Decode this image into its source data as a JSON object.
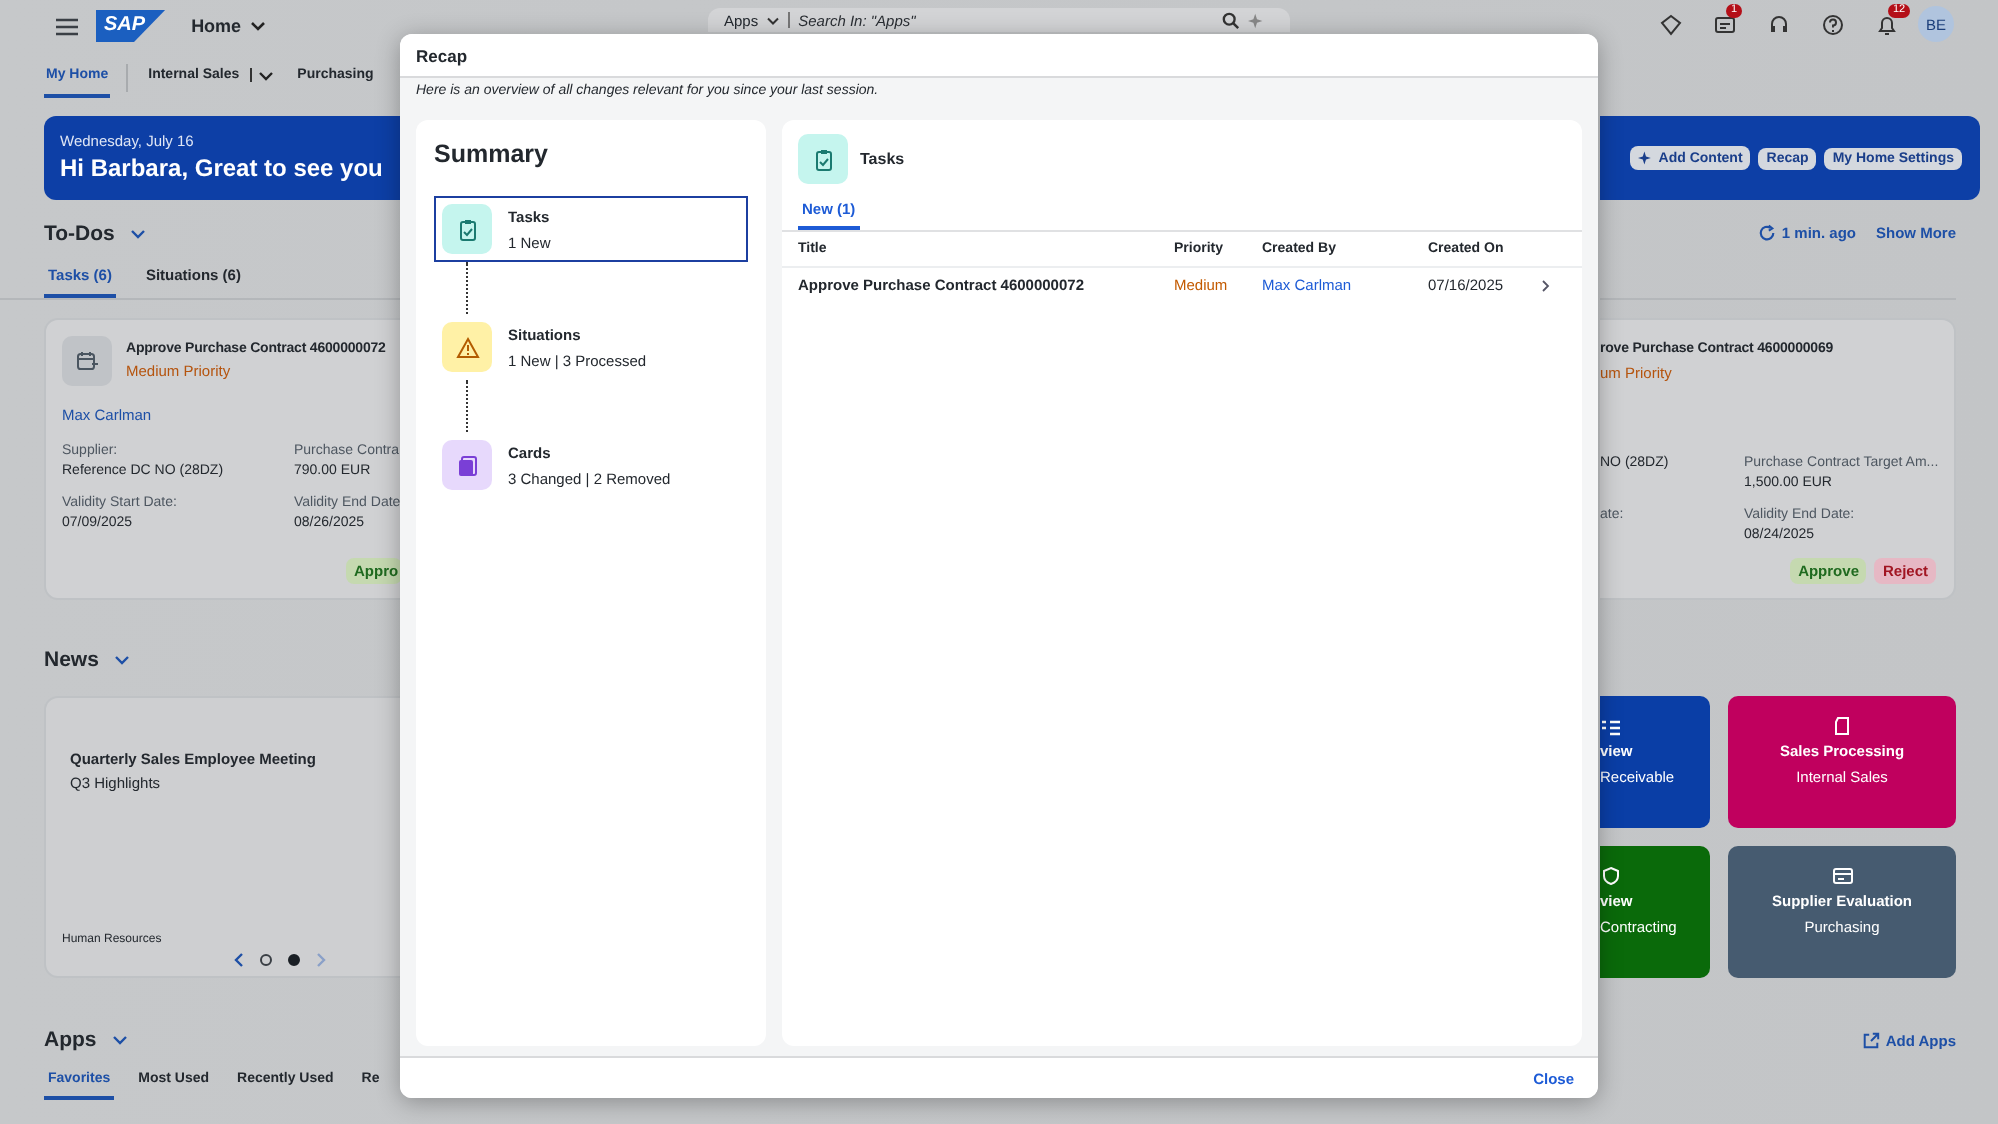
{
  "shell": {
    "logo": "SAP",
    "title": "Home",
    "search_scope": "Apps",
    "search_placeholder": "Search In: \"Apps\"",
    "inbox_badge": "1",
    "notifications_badge": "12",
    "avatar": "BE"
  },
  "nav_tabs": [
    {
      "label": "My Home",
      "selected": true,
      "has_menu": false
    },
    {
      "label": "Internal Sales",
      "selected": false,
      "has_menu": true
    },
    {
      "label": "Purchasing",
      "selected": false,
      "has_menu": false
    }
  ],
  "banner": {
    "date": "Wednesday, July 16",
    "greeting": "Hi Barbara, Great to see you",
    "buttons": [
      "Add Content",
      "Recap",
      "My Home Settings"
    ]
  },
  "todos": {
    "title": "To-Dos",
    "refreshed": "1 min. ago",
    "show_more": "Show More",
    "tabs": [
      {
        "label": "Tasks (6)",
        "selected": true
      },
      {
        "label": "Situations (6)",
        "selected": false
      }
    ],
    "left_card": {
      "title": "Approve Purchase Contract 4600000072",
      "priority": "Medium Priority",
      "owner": "Max Carlman",
      "fields": [
        {
          "label": "Supplier:",
          "value": "Reference DC NO (28DZ)"
        },
        {
          "label": "Purchase Contra",
          "value": "790.00 EUR"
        },
        {
          "label": "Validity Start Date:",
          "value": "07/09/2025"
        },
        {
          "label": "Validity End Date",
          "value": "08/26/2025"
        }
      ],
      "actions": [
        {
          "label": "Appro",
          "kind": "accept"
        }
      ]
    },
    "right_card": {
      "title": "rove Purchase Contract 4600000069",
      "priority": "um Priority",
      "fields": [
        {
          "value": "NO (28DZ)"
        },
        {
          "label": "Purchase Contract Target Am...",
          "value": "1,500.00 EUR"
        },
        {
          "label": "ate:"
        },
        {
          "label": "Validity End Date:",
          "value": "08/24/2025"
        }
      ],
      "actions": [
        {
          "label": "Approve",
          "kind": "accept"
        },
        {
          "label": "Reject",
          "kind": "reject"
        }
      ]
    }
  },
  "news": {
    "title": "News",
    "card": {
      "title": "Quarterly Sales Employee Meeting",
      "subtitle": "Q3 Highlights",
      "category": "Human Resources",
      "pages": [
        {
          "selected": false
        },
        {
          "selected": true
        }
      ]
    }
  },
  "tiles": [
    {
      "kind": "chart",
      "title": "view",
      "subtitle": "Receivable",
      "color": "#0a3ea6"
    },
    {
      "kind": "document",
      "title": "Sales Processing",
      "subtitle": "Internal Sales",
      "color": "#c0005e"
    },
    {
      "kind": "shield",
      "title": "view",
      "subtitle": "Contracting",
      "color": "#0a6a0a"
    },
    {
      "kind": "card",
      "title": "Supplier Evaluation",
      "subtitle": "Purchasing",
      "color": "#465b70"
    }
  ],
  "apps": {
    "title": "Apps",
    "add": "Add Apps",
    "tabs": [
      {
        "label": "Favorites",
        "selected": true
      },
      {
        "label": "Most Used",
        "selected": false
      },
      {
        "label": "Recently Used",
        "selected": false
      },
      {
        "label": "Re",
        "selected": false
      }
    ]
  },
  "dialog": {
    "title": "Recap",
    "intro": "Here is an overview of all changes relevant for you since your last session.",
    "summary": {
      "title": "Summary",
      "items": [
        {
          "kind": "tasks",
          "label": "Tasks",
          "detail": "1 New",
          "selected": true
        },
        {
          "kind": "situations",
          "label": "Situations",
          "detail": "1 New | 3 Processed",
          "selected": false
        },
        {
          "kind": "cards",
          "label": "Cards",
          "detail": "3 Changed | 2 Removed",
          "selected": false
        }
      ]
    },
    "detail": {
      "title": "Tasks",
      "tabs": [
        {
          "label": "New (1)",
          "selected": true
        }
      ],
      "columns": [
        "Title",
        "Priority",
        "Created By",
        "Created On"
      ],
      "rows": [
        {
          "title": "Approve Purchase Contract 4600000072",
          "priority": "Medium",
          "created_by": "Max Carlman",
          "created_on": "07/16/2025"
        }
      ]
    },
    "close": "Close"
  }
}
